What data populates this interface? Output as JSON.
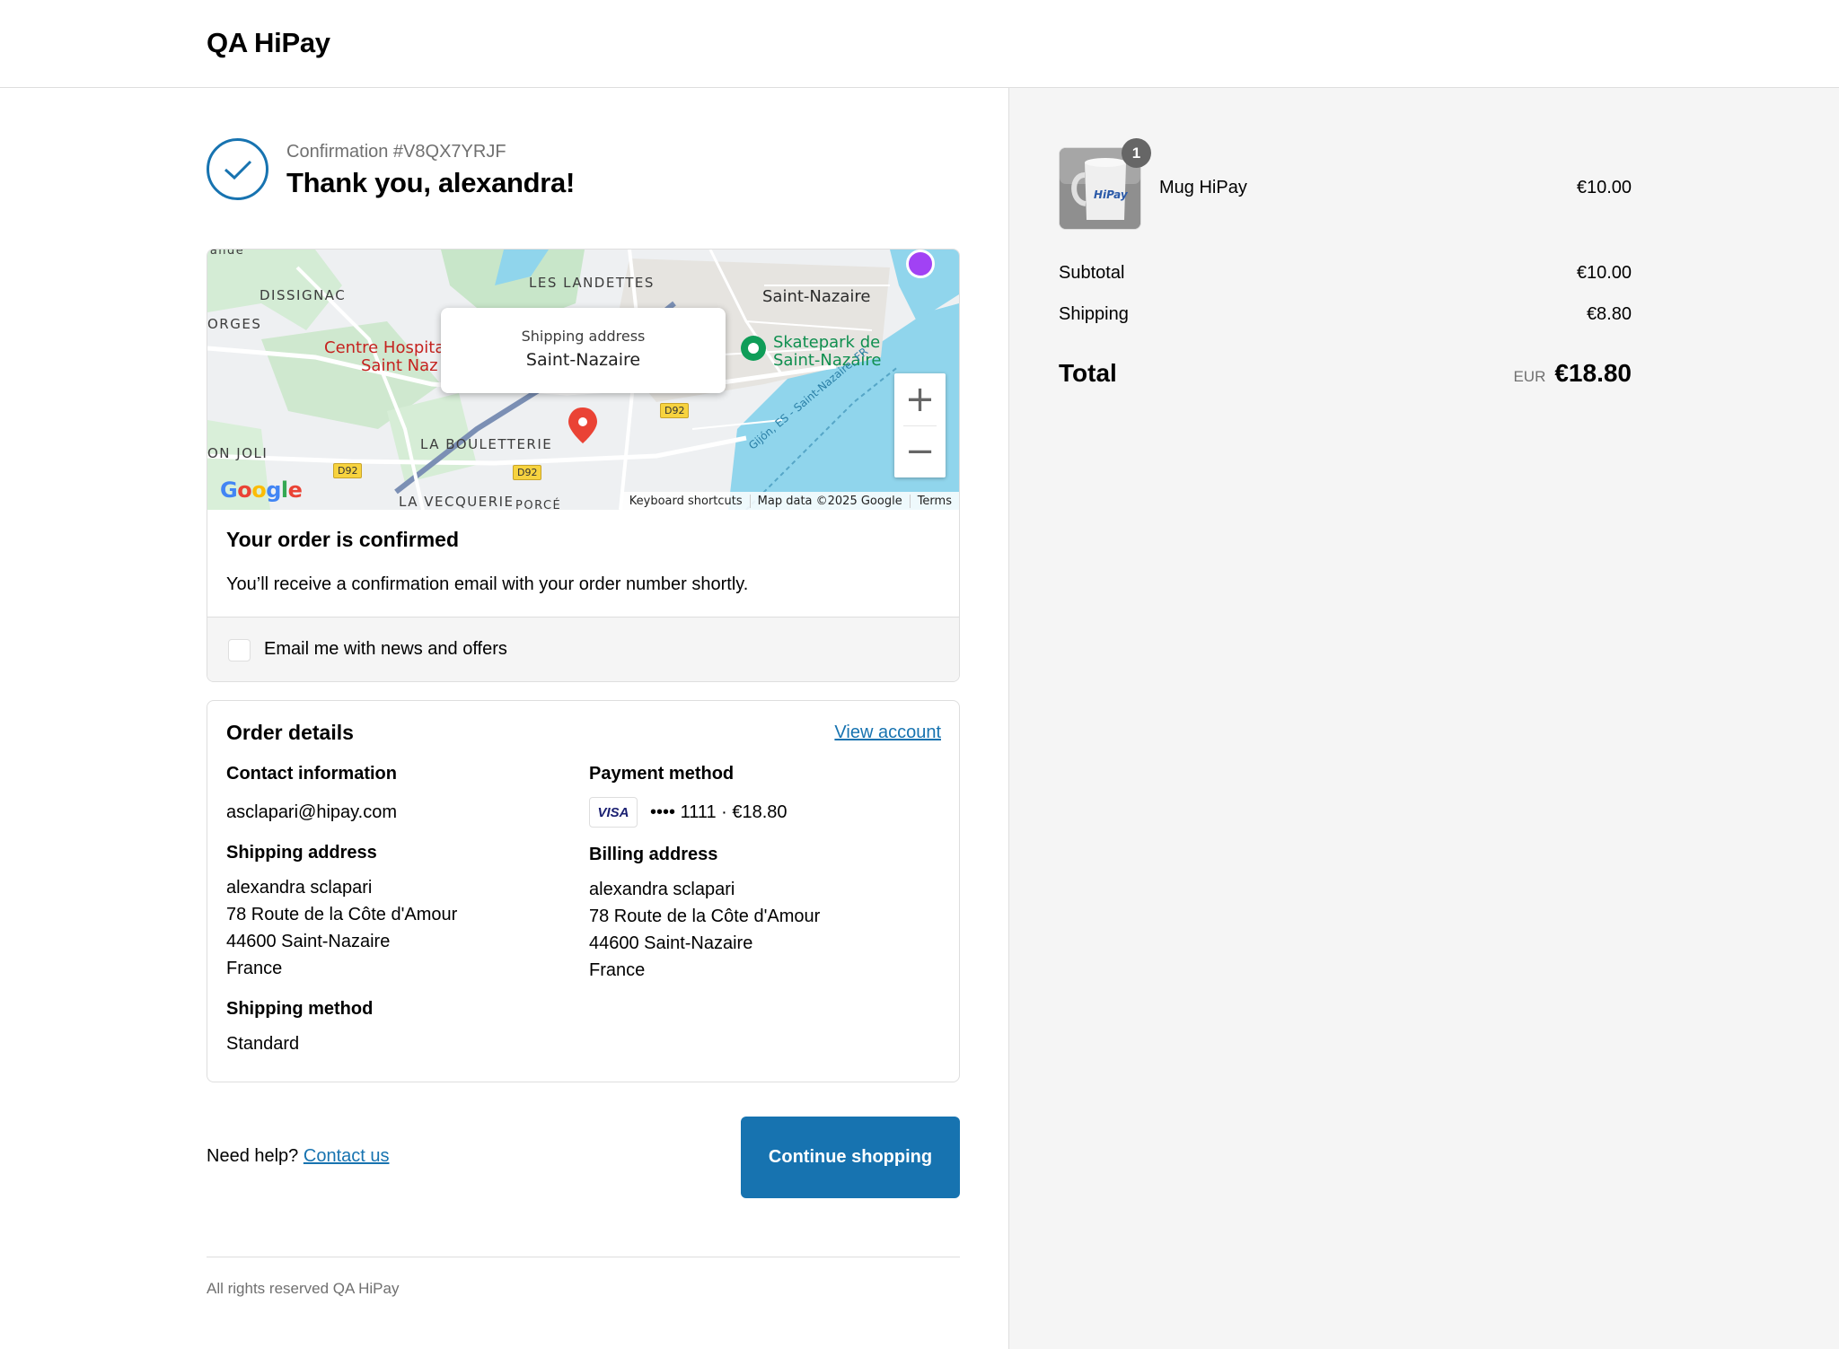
{
  "brand": "QA HiPay",
  "confirmation": {
    "number": "Confirmation #V8QX7YRJF",
    "thanks": "Thank you, alexandra!"
  },
  "map": {
    "popup_title": "Shipping address",
    "popup_city": "Saint-Nazaire",
    "labels": {
      "dissignac": "DISSIGNAC",
      "orges": "ORGES",
      "les_landettes": "LES LANDETTES",
      "saint_nazaire": "Saint-Nazaire",
      "centre_hosp_1": "Centre Hospita",
      "centre_hosp_2": "Saint Naz",
      "skatepark_1": "Skatepark de",
      "skatepark_2": "Saint-Nazaire",
      "la_bouletterie": "LA BOULETTERIE",
      "on_joli": "ON JOLI",
      "la_vecquerie": "LA VECQUERIE",
      "porce": "PORCÉ",
      "ferry": "Gijón, ES - Saint-Nazaire, FR",
      "road_d92": "D92"
    },
    "zoom_in": "+",
    "zoom_out": "−",
    "google": [
      "G",
      "o",
      "o",
      "g",
      "l",
      "e"
    ],
    "footer": {
      "shortcuts": "Keyboard shortcuts",
      "data": "Map data ©2025 Google",
      "terms": "Terms"
    }
  },
  "order_confirmed": {
    "title": "Your order is confirmed",
    "message": "You’ll receive a confirmation email with your order number shortly.",
    "newsletter_label": "Email me with news and offers"
  },
  "order_details": {
    "title": "Order details",
    "view_account": "View account",
    "contact": {
      "heading": "Contact information",
      "email": "asclapari@hipay.com"
    },
    "shipping_address": {
      "heading": "Shipping address",
      "lines": [
        "alexandra sclapari",
        "78 Route de la Côte d'Amour",
        "44600 Saint-Nazaire",
        "France"
      ]
    },
    "shipping_method": {
      "heading": "Shipping method",
      "value": "Standard"
    },
    "payment": {
      "heading": "Payment method",
      "card_brand": "VISA",
      "summary": "•••• 1111 · €18.80"
    },
    "billing_address": {
      "heading": "Billing address",
      "lines": [
        "alexandra sclapari",
        "78 Route de la Côte d'Amour",
        "44600 Saint-Nazaire",
        "France"
      ]
    }
  },
  "footer": {
    "help_prefix": "Need help?",
    "contact_link": "Contact us",
    "continue_button": "Continue shopping",
    "rights": "All rights reserved QA HiPay"
  },
  "cart": {
    "item": {
      "name": "Mug HiPay",
      "quantity": "1",
      "price": "€10.00",
      "mug_logo": "HiPay"
    },
    "subtotal_label": "Subtotal",
    "subtotal": "€10.00",
    "shipping_label": "Shipping",
    "shipping": "€8.80",
    "total_label": "Total",
    "currency": "EUR",
    "total": "€18.80"
  },
  "colors": {
    "accent": "#1773b0",
    "sidebar_bg": "#f5f5f5",
    "border": "#dedede",
    "muted_text": "#707070"
  },
  "icons": {
    "check": "check-icon",
    "map_pin": "map-pin-icon",
    "poi": "poi-icon",
    "camera": "camera-icon",
    "checkbox": "checkbox-icon",
    "visa": "visa-card-icon"
  }
}
